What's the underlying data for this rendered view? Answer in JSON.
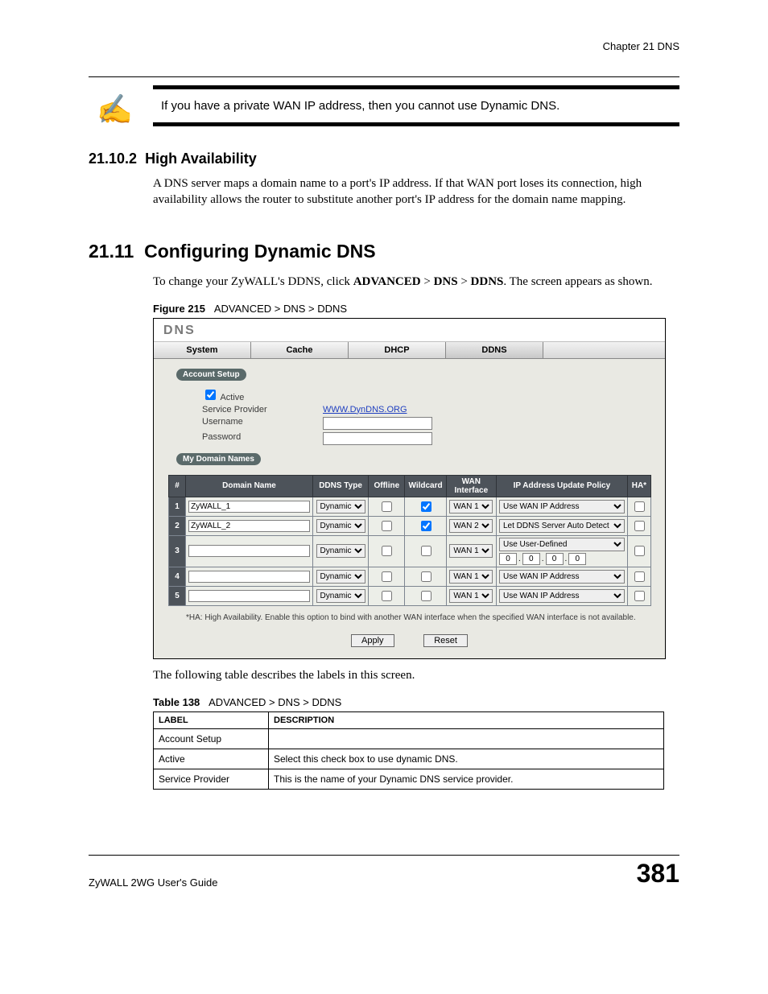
{
  "header": {
    "chapter": "Chapter 21 DNS"
  },
  "note": {
    "icon": "✍",
    "text": "If you have a private WAN IP address, then you cannot use Dynamic DNS."
  },
  "sec_ha": {
    "num": "21.10.2",
    "title": "High Availability",
    "para": "A DNS server maps a domain name to a port's IP address. If that WAN port loses its connection, high availability allows the router to substitute another port's IP address for the domain name mapping."
  },
  "sec_cfg": {
    "num": "21.11",
    "title": "Configuring Dynamic DNS",
    "para_a": "To change your ZyWALL's DDNS, click ",
    "para_b": "ADVANCED",
    "para_c": " > ",
    "para_d": "DNS",
    "para_e": " > ",
    "para_f": "DDNS",
    "para_g": ". The screen appears as shown."
  },
  "figure": {
    "label": "Figure 215",
    "title": "ADVANCED > DNS > DDNS"
  },
  "screenshot": {
    "title": "DNS",
    "tabs": [
      "System",
      "Cache",
      "DHCP",
      "DDNS"
    ],
    "active_tab": 3,
    "account_section": "Account Setup",
    "active_label": "Active",
    "active_checked": true,
    "sp_label": "Service Provider",
    "sp_link": "WWW.DynDNS.ORG",
    "user_label": "Username",
    "user_value": "",
    "pass_label": "Password",
    "pass_value": "",
    "domains_section": "My Domain Names",
    "cols": {
      "idx": "#",
      "name": "Domain Name",
      "type": "DDNS Type",
      "offline": "Offline",
      "wildcard": "Wildcard",
      "wan": "WAN Interface",
      "policy": "IP Address Update Policy",
      "ha": "HA*"
    },
    "rows": [
      {
        "n": "1",
        "name": "ZyWALL_1",
        "type": "Dynamic",
        "offline": false,
        "wildcard": true,
        "wan": "WAN 1",
        "policy": "Use WAN IP Address",
        "userdef": false,
        "ha": false
      },
      {
        "n": "2",
        "name": "ZyWALL_2",
        "type": "Dynamic",
        "offline": false,
        "wildcard": true,
        "wan": "WAN 2",
        "policy": "Let DDNS Server Auto Detect",
        "userdef": false,
        "ha": false
      },
      {
        "n": "3",
        "name": "",
        "type": "Dynamic",
        "offline": false,
        "wildcard": false,
        "wan": "WAN 1",
        "policy": "Use User-Defined",
        "userdef": true,
        "ip": [
          "0",
          "0",
          "0",
          "0"
        ],
        "ha": false
      },
      {
        "n": "4",
        "name": "",
        "type": "Dynamic",
        "offline": false,
        "wildcard": false,
        "wan": "WAN 1",
        "policy": "Use WAN IP Address",
        "userdef": false,
        "ha": false
      },
      {
        "n": "5",
        "name": "",
        "type": "Dynamic",
        "offline": false,
        "wildcard": false,
        "wan": "WAN 1",
        "policy": "Use WAN IP Address",
        "userdef": false,
        "ha": false
      }
    ],
    "ha_note": "*HA: High Availability. Enable this option to bind with another WAN interface when the specified WAN interface is not available.",
    "apply": "Apply",
    "reset": "Reset"
  },
  "after_fig": "The following table describes the labels in this screen.",
  "table": {
    "label": "Table 138",
    "title": "ADVANCED > DNS > DDNS",
    "head_label": "LABEL",
    "head_desc": "DESCRIPTION",
    "rows": [
      {
        "label": "Account Setup",
        "desc": ""
      },
      {
        "label": "Active",
        "desc": "Select this check box to use dynamic DNS."
      },
      {
        "label": "Service Provider",
        "desc": "This is the name of your Dynamic DNS service provider."
      }
    ]
  },
  "footer": {
    "guide": "ZyWALL 2WG User's Guide",
    "page": "381"
  }
}
